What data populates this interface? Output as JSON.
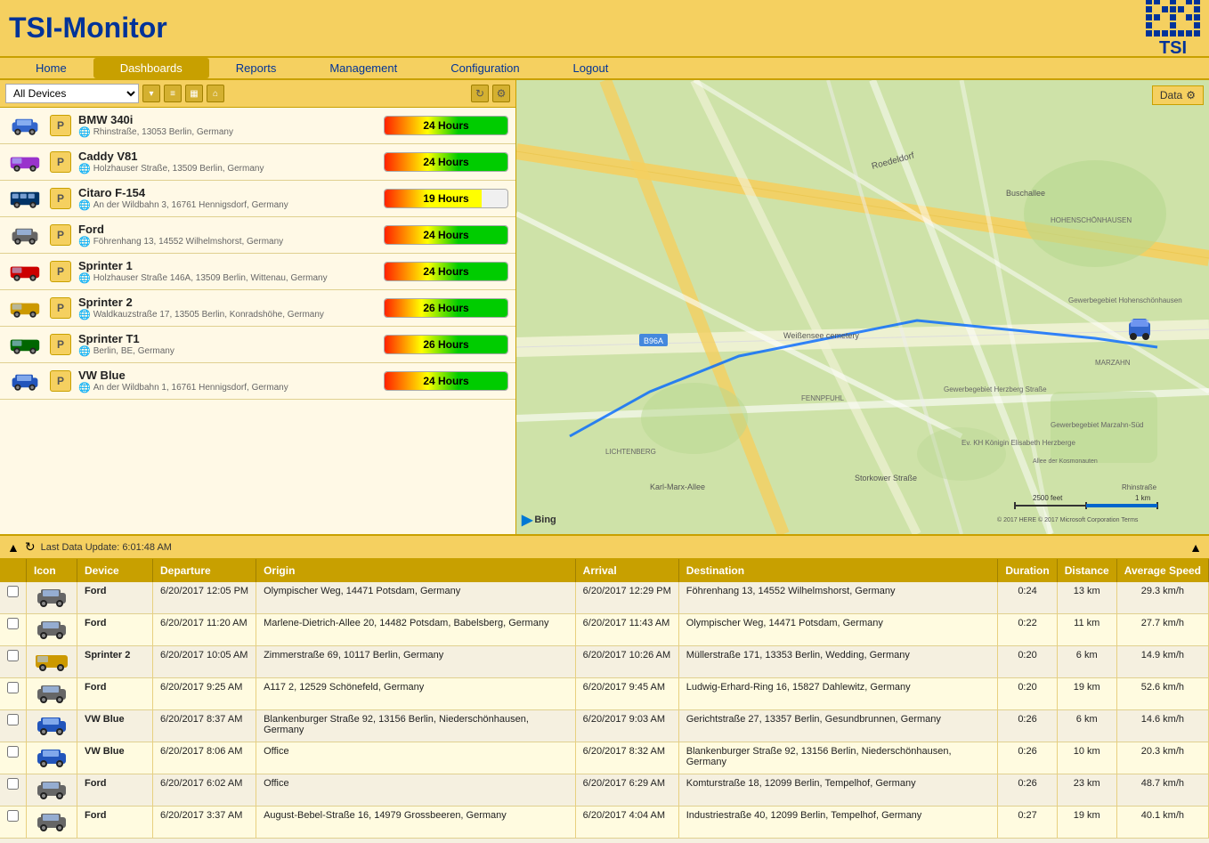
{
  "header": {
    "title": "TSI-Monitor"
  },
  "nav": {
    "items": [
      "Home",
      "Dashboards",
      "Reports",
      "Management",
      "Configuration",
      "Logout"
    ],
    "active": "Dashboards"
  },
  "device_toolbar": {
    "select_value": "All Devices",
    "select_options": [
      "All Devices"
    ]
  },
  "vehicles": [
    {
      "name": "BMW 340i",
      "address": "Rhinstraße, 13053 Berlin, Germany",
      "hours_label": "24 Hours",
      "hours_type": "bar-24",
      "color": "#3366cc",
      "icon_type": "car"
    },
    {
      "name": "Caddy V81",
      "address": "Holzhauser Straße, 13509 Berlin, Germany",
      "hours_label": "24 Hours",
      "hours_type": "bar-24",
      "color": "#9933cc",
      "icon_type": "van"
    },
    {
      "name": "Citaro F-154",
      "address": "An der Wildbahn 3, 16761 Hennigsdorf, Germany",
      "hours_label": "19 Hours",
      "hours_type": "bar-19",
      "color": "#003366",
      "icon_type": "bus"
    },
    {
      "name": "Ford",
      "address": "Föhrenhang 13, 14552 Wilhelmshorst, Germany",
      "hours_label": "24 Hours",
      "hours_type": "bar-24",
      "color": "#666666",
      "icon_type": "car"
    },
    {
      "name": "Sprinter 1",
      "address": "Holzhauser Straße 146A, 13509 Berlin, Wittenau, Germany",
      "hours_label": "24 Hours",
      "hours_type": "bar-24",
      "color": "#cc0000",
      "icon_type": "van"
    },
    {
      "name": "Sprinter 2",
      "address": "Waldkauzstraße 17, 13505 Berlin, Konradshöhe, Germany",
      "hours_label": "26 Hours",
      "hours_type": "bar-26",
      "color": "#cc9900",
      "icon_type": "van"
    },
    {
      "name": "Sprinter T1",
      "address": "Berlin, BE, Germany",
      "hours_label": "26 Hours",
      "hours_type": "bar-26",
      "color": "#006600",
      "icon_type": "van"
    },
    {
      "name": "VW Blue",
      "address": "An der Wildbahn 1, 16761 Hennigsdorf, Germany",
      "hours_label": "24 Hours",
      "hours_type": "bar-24",
      "color": "#2255bb",
      "icon_type": "car"
    }
  ],
  "map": {
    "data_label": "Data",
    "bing_label": "Bing",
    "scale_feet": "2500 feet",
    "scale_km": "1 km",
    "copyright": "© 2017 HERE © 2017 Microsoft Corporation Terms"
  },
  "bottom": {
    "last_update": "Last Data Update: 6:01:48 AM"
  },
  "table": {
    "headers": [
      "Icon",
      "Device",
      "Departure",
      "Origin",
      "Arrival",
      "Destination",
      "Duration",
      "Distance",
      "Average Speed"
    ],
    "rows": [
      {
        "icon_type": "car",
        "icon_color": "#666",
        "device": "Ford",
        "departure": "6/20/2017 12:05 PM",
        "origin": "Olympischer Weg, 14471 Potsdam, Germany",
        "arrival": "6/20/2017 12:29 PM",
        "destination": "Föhrenhang 13, 14552 Wilhelmshorst, Germany",
        "duration": "0:24",
        "distance": "13 km",
        "avg_speed": "29.3 km/h"
      },
      {
        "icon_type": "car",
        "icon_color": "#666",
        "device": "Ford",
        "departure": "6/20/2017 11:20 AM",
        "origin": "Marlene-Dietrich-Allee 20, 14482 Potsdam, Babelsberg, Germany",
        "arrival": "6/20/2017 11:43 AM",
        "destination": "Olympischer Weg, 14471 Potsdam, Germany",
        "duration": "0:22",
        "distance": "11 km",
        "avg_speed": "27.7 km/h"
      },
      {
        "icon_type": "van",
        "icon_color": "#cc9900",
        "device": "Sprinter 2",
        "departure": "6/20/2017 10:05 AM",
        "origin": "Zimmerstraße 69, 10117 Berlin, Germany",
        "arrival": "6/20/2017 10:26 AM",
        "destination": "Müllerstraße 171, 13353 Berlin, Wedding, Germany",
        "duration": "0:20",
        "distance": "6 km",
        "avg_speed": "14.9 km/h"
      },
      {
        "icon_type": "car",
        "icon_color": "#666",
        "device": "Ford",
        "departure": "6/20/2017 9:25 AM",
        "origin": "A117 2, 12529 Schönefeld, Germany",
        "arrival": "6/20/2017 9:45 AM",
        "destination": "Ludwig-Erhard-Ring 16, 15827 Dahlewitz, Germany",
        "duration": "0:20",
        "distance": "19 km",
        "avg_speed": "52.6 km/h"
      },
      {
        "icon_type": "car",
        "icon_color": "#2255bb",
        "device": "VW Blue",
        "departure": "6/20/2017 8:37 AM",
        "origin": "Blankenburger Straße 92, 13156 Berlin, Niederschönhausen, Germany",
        "arrival": "6/20/2017 9:03 AM",
        "destination": "Gerichtstraße 27, 13357 Berlin, Gesundbrunnen, Germany",
        "duration": "0:26",
        "distance": "6 km",
        "avg_speed": "14.6 km/h"
      },
      {
        "icon_type": "car",
        "icon_color": "#2255bb",
        "device": "VW Blue",
        "departure": "6/20/2017 8:06 AM",
        "origin": "Office",
        "arrival": "6/20/2017 8:32 AM",
        "destination": "Blankenburger Straße 92, 13156 Berlin, Niederschönhausen, Germany",
        "duration": "0:26",
        "distance": "10 km",
        "avg_speed": "20.3 km/h"
      },
      {
        "icon_type": "car",
        "icon_color": "#666",
        "device": "Ford",
        "departure": "6/20/2017 6:02 AM",
        "origin": "Office",
        "arrival": "6/20/2017 6:29 AM",
        "destination": "Komturstraße 18, 12099 Berlin, Tempelhof, Germany",
        "duration": "0:26",
        "distance": "23 km",
        "avg_speed": "48.7 km/h"
      },
      {
        "icon_type": "car",
        "icon_color": "#666",
        "device": "Ford",
        "departure": "6/20/2017 3:37 AM",
        "origin": "August-Bebel-Straße 16, 14979 Grossbeeren, Germany",
        "arrival": "6/20/2017 4:04 AM",
        "destination": "Industriestraße 40, 12099 Berlin, Tempelhof, Germany",
        "duration": "0:27",
        "distance": "19 km",
        "avg_speed": "40.1 km/h"
      }
    ]
  }
}
